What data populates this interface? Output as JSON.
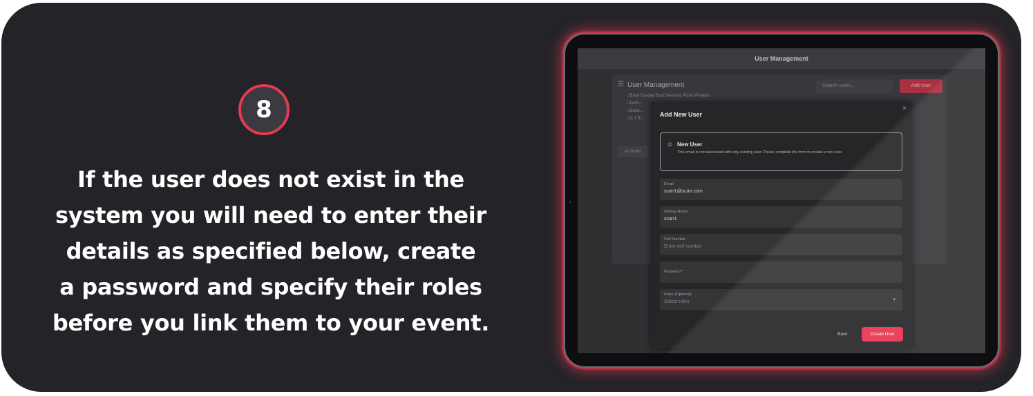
{
  "step": {
    "number": "8",
    "accent_color": "#e63a52"
  },
  "instructions": {
    "lines": [
      "If the user does not exist in the",
      "system you will need to enter their",
      "details as specified below, create",
      "a password and specify their roles",
      "before you link them to your event."
    ]
  },
  "app": {
    "header_title": "User Management",
    "panel_title": "User Management",
    "background_list": [
      "Easy Sunday Soul Sessions Picnic Protests",
      "Lefts...",
      "Sund...",
      "C.T B..."
    ],
    "search_placeholder": "Search users...",
    "add_user_label": "Add User",
    "filter_label": "All Roles",
    "modal": {
      "title": "Add New User",
      "close_symbol": "×",
      "notice_title": "New User",
      "notice_text": "This email is not associated with any existing user. Please complete the form to create a new user.",
      "fields": [
        {
          "label": "Email",
          "value": "scan1@scan.com",
          "placeholder": false
        },
        {
          "label": "Display Name",
          "value": "scan1",
          "placeholder": false
        },
        {
          "label": "Cell Number",
          "value": "Enter cell number",
          "placeholder": true
        },
        {
          "label": "Password *",
          "value": "",
          "placeholder": true
        },
        {
          "label": "Roles (Optional)",
          "value": "Select roles",
          "placeholder": true
        }
      ],
      "back_label": "Back",
      "create_label": "Create User"
    }
  },
  "colors": {
    "card_background": "#232328",
    "button_primary": "#e8334f"
  }
}
